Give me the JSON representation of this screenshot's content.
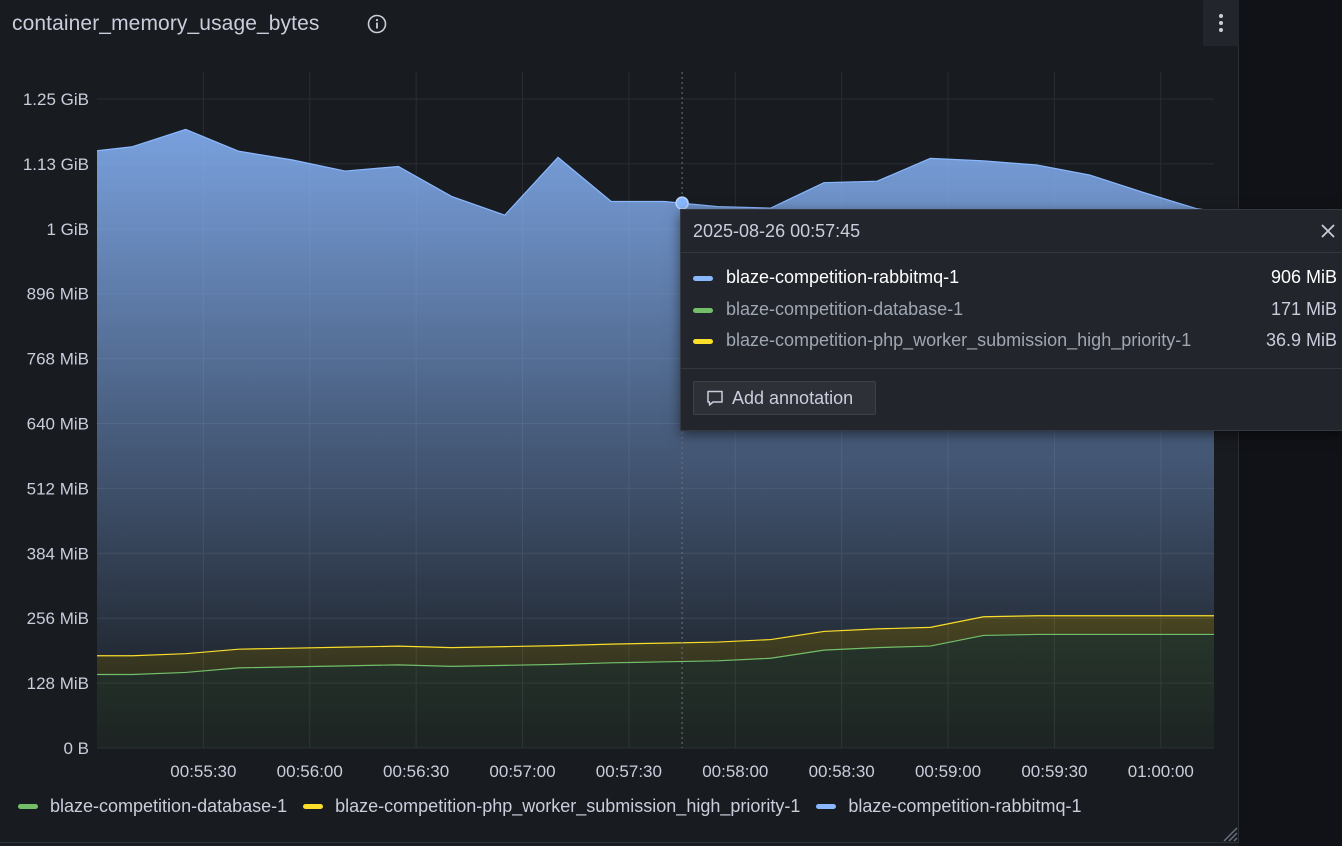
{
  "panel": {
    "title": "container_memory_usage_bytes"
  },
  "icons": {
    "info": "info-icon",
    "menu": "vertical-dots-icon",
    "close": "close-icon",
    "annotation": "comment-icon",
    "resize": "resize-handle-icon"
  },
  "tooltip": {
    "time": "2025-08-26 00:57:45",
    "rows": [
      {
        "name": "blaze-competition-rabbitmq-1",
        "value": "906 MiB",
        "color": "#8ab8ff"
      },
      {
        "name": "blaze-competition-database-1",
        "value": "171 MiB",
        "color": "#73bf69"
      },
      {
        "name": "blaze-competition-php_worker_submission_high_priority-1",
        "value": "36.9 MiB",
        "color": "#fade2a"
      }
    ],
    "add_annotation_label": "Add annotation"
  },
  "legend": [
    {
      "name": "blaze-competition-database-1",
      "color": "#73bf69"
    },
    {
      "name": "blaze-competition-php_worker_submission_high_priority-1",
      "color": "#fade2a"
    },
    {
      "name": "blaze-competition-rabbitmq-1",
      "color": "#8ab8ff"
    }
  ],
  "chart_data": {
    "type": "area",
    "stacked": true,
    "y_unit": "MiB",
    "ylim": [
      0,
      1280
    ],
    "yticks": [
      {
        "value": 0,
        "label": "0 B"
      },
      {
        "value": 128,
        "label": "128 MiB"
      },
      {
        "value": 256,
        "label": "256 MiB"
      },
      {
        "value": 384,
        "label": "384 MiB"
      },
      {
        "value": 512,
        "label": "512 MiB"
      },
      {
        "value": 640,
        "label": "640 MiB"
      },
      {
        "value": 768,
        "label": "768 MiB"
      },
      {
        "value": 896,
        "label": "896 MiB"
      },
      {
        "value": 1024,
        "label": "1 GiB"
      },
      {
        "value": 1152,
        "label": "1.13 GiB"
      },
      {
        "value": 1280,
        "label": "1.25 GiB"
      }
    ],
    "xlim": [
      "00:55:00",
      "01:00:15"
    ],
    "xticks": [
      "00:55:30",
      "00:56:00",
      "00:56:30",
      "00:57:00",
      "00:57:30",
      "00:58:00",
      "00:58:30",
      "00:59:00",
      "00:59:30",
      "01:00:00"
    ],
    "x": [
      "00:55:00",
      "00:55:10",
      "00:55:25",
      "00:55:40",
      "00:55:55",
      "00:56:10",
      "00:56:25",
      "00:56:40",
      "00:56:55",
      "00:57:10",
      "00:57:25",
      "00:57:40",
      "00:57:55",
      "00:58:10",
      "00:58:25",
      "00:58:40",
      "00:58:55",
      "00:59:10",
      "00:59:25",
      "00:59:40",
      "00:59:55",
      "01:00:10",
      "01:00:15"
    ],
    "hover_x": "00:57:45",
    "grid": true,
    "legend_position": "bottom-left",
    "series": [
      {
        "name": "blaze-competition-database-1",
        "color": "#73bf69",
        "values": [
          145,
          145,
          149,
          158,
          160,
          162,
          164,
          161,
          163,
          165,
          168,
          170,
          172,
          177,
          193,
          198,
          201,
          222,
          224,
          224,
          224,
          224,
          224
        ]
      },
      {
        "name": "blaze-competition-php_worker_submission_high_priority-1",
        "color": "#fade2a",
        "values": [
          36.9,
          36.9,
          37.0,
          36.9,
          36.9,
          36.9,
          36.9,
          36.9,
          36.9,
          36.9,
          36.9,
          36.9,
          36.9,
          36.9,
          36.9,
          36.9,
          36.9,
          36.9,
          36.9,
          36.9,
          36.9,
          36.9,
          36.9
        ]
      },
      {
        "name": "blaze-competition-rabbitmq-1",
        "color": "#8ab8ff",
        "values": [
          996,
          1004,
          1034,
          982,
          963,
          939,
          946,
          890,
          851,
          963,
          873,
          871,
          859,
          851,
          885,
          883,
          925,
          899,
          889,
          869,
          835,
          803,
          798
        ]
      }
    ]
  }
}
